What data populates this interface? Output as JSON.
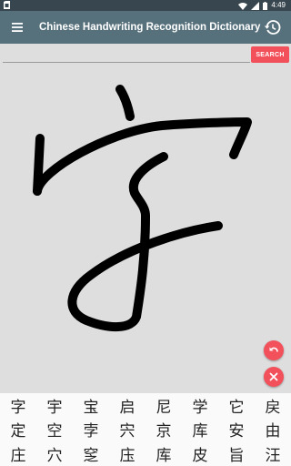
{
  "status_bar": {
    "time": "4:49",
    "icons": [
      "sim-card-icon",
      "wifi-icon",
      "signal-icon",
      "battery-icon"
    ]
  },
  "app_bar": {
    "title": "Chinese Handwriting Recognition Dictionary",
    "menu_icon": "hamburger-menu-icon",
    "history_icon": "history-icon",
    "background": "#56707c"
  },
  "search": {
    "value": "",
    "placeholder": "",
    "button_label": "SEARCH",
    "accent": "#f2505a"
  },
  "canvas": {
    "content": "handwritten stroke drawing",
    "stroke_color": "#000000"
  },
  "fabs": {
    "undo_icon": "undo-icon",
    "clear_icon": "close-icon"
  },
  "candidates": [
    "字",
    "宇",
    "宝",
    "启",
    "尼",
    "学",
    "它",
    "戻",
    "定",
    "空",
    "孛",
    "宍",
    "京",
    "库",
    "安",
    "由",
    "庄",
    "穴",
    "窆",
    "庒",
    "库",
    "皮",
    "旨",
    "汪"
  ]
}
